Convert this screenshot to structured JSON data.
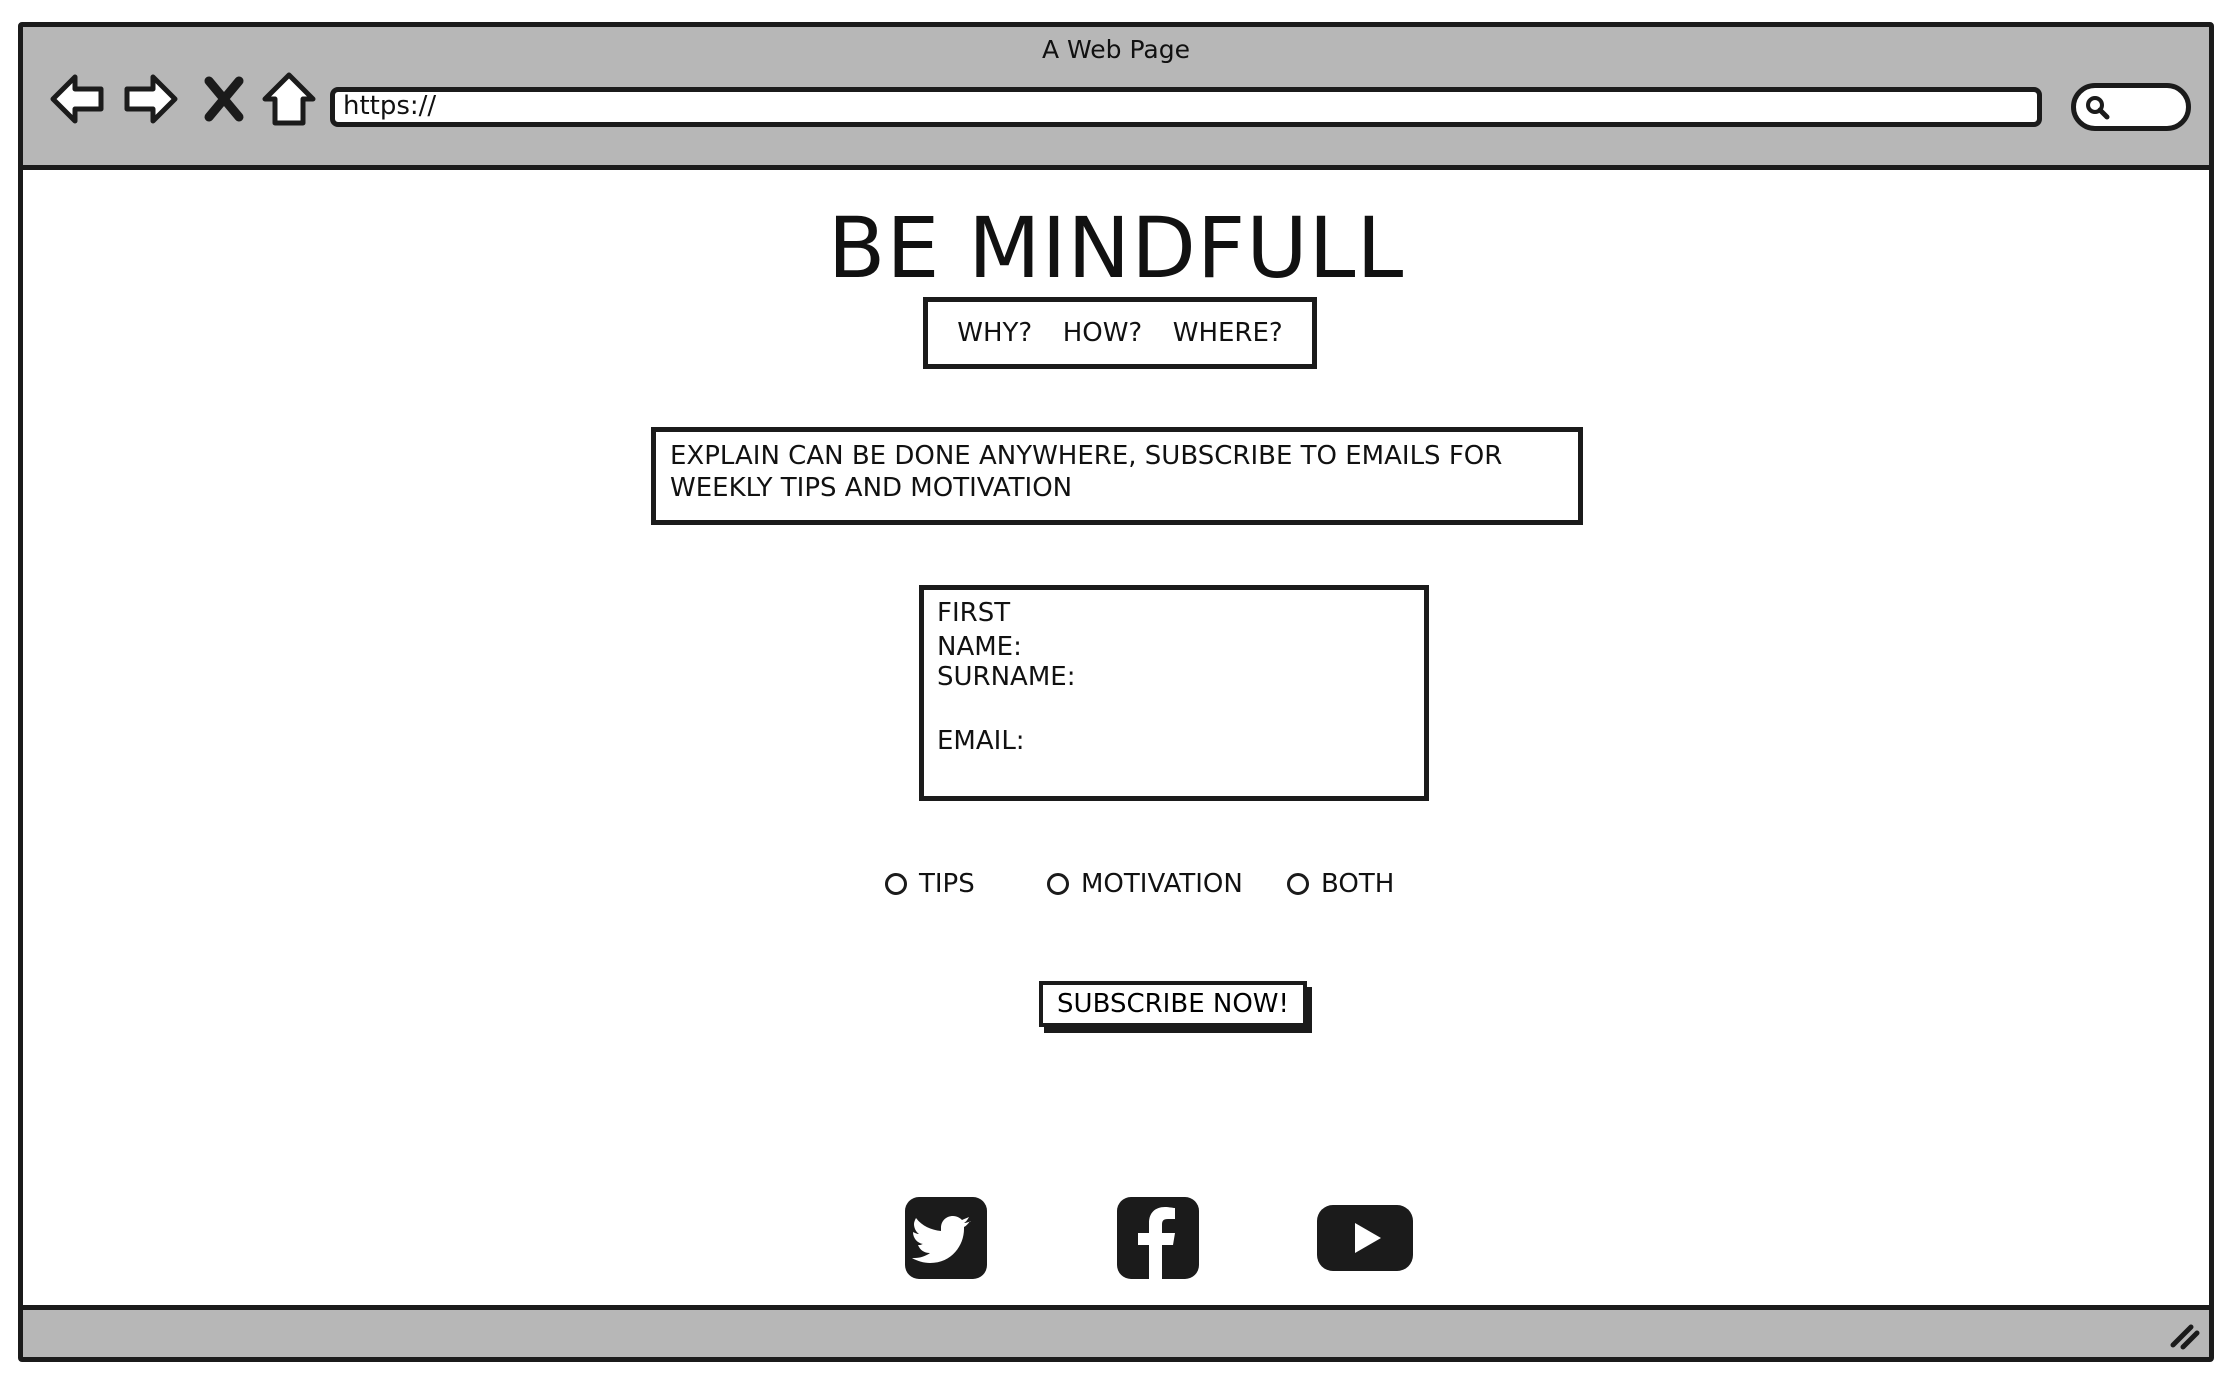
{
  "browser": {
    "title": "A Web Page",
    "url": "https://",
    "nav_icons": [
      "back-arrow-icon",
      "forward-arrow-icon",
      "stop-icon",
      "home-icon"
    ],
    "search_icon": "search-icon"
  },
  "page": {
    "heading": "BE MINDFULL",
    "nav": [
      {
        "label": "WHY?"
      },
      {
        "label": "HOW?"
      },
      {
        "label": "WHERE?"
      }
    ],
    "explain_text": "EXPLAIN CAN BE DONE ANYWHERE, SUBSCRIBE TO EMAILS FOR WEEKLY TIPS AND MOTIVATION",
    "form": {
      "first_name_label": "FIRST NAME:",
      "surname_label": "SURNAME:",
      "email_label": "EMAIL:"
    },
    "options": [
      {
        "label": "TIPS"
      },
      {
        "label": "MOTIVATION"
      },
      {
        "label": "BOTH"
      }
    ],
    "subscribe_label": "SUBSCRIBE NOW!",
    "social_icons": [
      "twitter-icon",
      "facebook-icon",
      "youtube-icon"
    ]
  },
  "colors": {
    "chrome": "#b7b7b7",
    "ink": "#1b1b1b",
    "background": "#ffffff"
  }
}
